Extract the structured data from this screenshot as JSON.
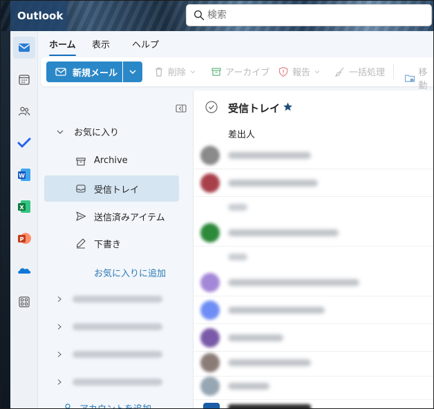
{
  "app": {
    "name": "Outlook"
  },
  "search": {
    "placeholder": "検索"
  },
  "rail": {
    "items": [
      {
        "icon": "mail-icon",
        "active": true
      },
      {
        "icon": "calendar-icon"
      },
      {
        "icon": "people-icon"
      },
      {
        "icon": "todo-icon"
      },
      {
        "icon": "word-icon"
      },
      {
        "icon": "excel-icon"
      },
      {
        "icon": "powerpoint-icon"
      },
      {
        "icon": "onedrive-icon"
      },
      {
        "icon": "apps-icon"
      }
    ]
  },
  "tabs": [
    {
      "label": "ホーム",
      "active": true
    },
    {
      "label": "表示"
    },
    {
      "label": "ヘルプ"
    }
  ],
  "ribbon": {
    "new_mail": "新規メール",
    "delete": "削除",
    "archive": "アーカイブ",
    "report": "報告",
    "sweep": "一括処理",
    "move": "移動"
  },
  "folders": {
    "favorites_label": "お気に入り",
    "items": [
      {
        "label": "Archive",
        "icon": "archive-icon"
      },
      {
        "label": "受信トレイ",
        "icon": "inbox-icon",
        "active": true
      },
      {
        "label": "送信済みアイテム",
        "icon": "send-icon"
      },
      {
        "label": "下書き",
        "icon": "draft-icon"
      }
    ],
    "add_favorite": "お気に入りに追加",
    "add_account": "アカウントを追加"
  },
  "list": {
    "title": "受信トレイ",
    "column_sender": "差出人"
  },
  "colors": {
    "accent": "#0f6cbd",
    "button": "#2b88c8",
    "selected": "#d5e5f2",
    "link": "#2a7ab8"
  }
}
